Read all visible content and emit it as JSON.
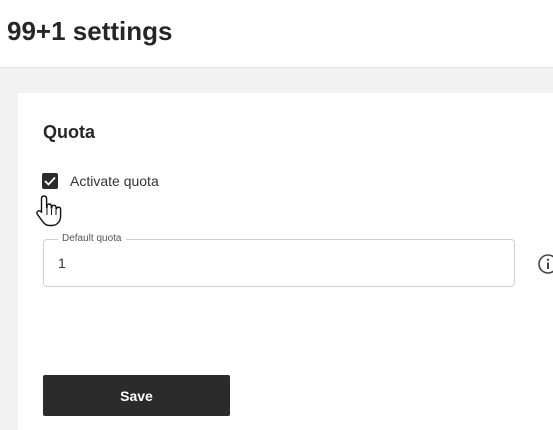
{
  "header": {
    "title": "99+1 settings"
  },
  "quota_section": {
    "title": "Quota",
    "activate_checkbox": {
      "label": "Activate quota",
      "checked": true
    },
    "default_quota_field": {
      "label": "Default quota",
      "value": "1"
    },
    "info_icon": "info-circle-icon"
  },
  "actions": {
    "save_label": "Save"
  },
  "cursor": "hand-pointer-icon",
  "colors": {
    "background": "#f2f2f2",
    "card": "#ffffff",
    "accent_dark": "#2b2b2b",
    "text": "#262626",
    "border": "#cfcfcf"
  }
}
